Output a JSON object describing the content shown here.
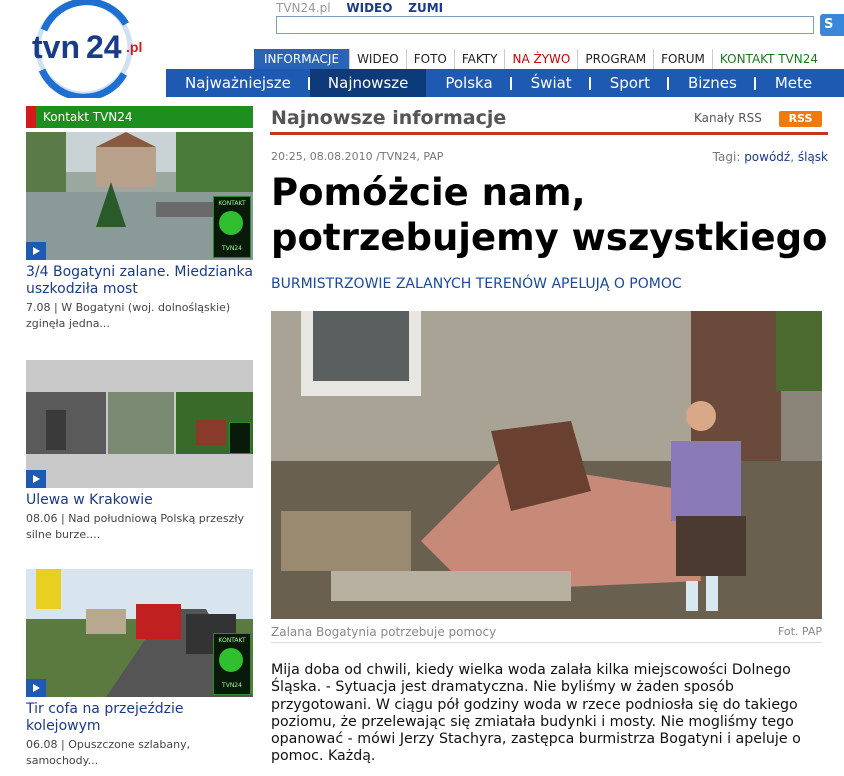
{
  "header": {
    "logo_text": "tvn24.pl",
    "top_links": [
      "TVN24.pl",
      "WIDEO",
      "ZUMI"
    ],
    "search_placeholder": "",
    "search_button": "S"
  },
  "top_nav": [
    "INFORMACJE",
    "WIDEO",
    "FOTO",
    "FAKTY",
    "NA ŻYWO",
    "PROGRAM",
    "FORUM",
    "KONTAKT TVN24"
  ],
  "main_nav": [
    "Najważniejsze",
    "Najnowsze",
    "Polska",
    "Świat",
    "Sport",
    "Biznes",
    "Mete"
  ],
  "sidebar": {
    "header": "Kontakt TVN24",
    "badge_text": "KONTAKT",
    "badge_sub": "TVN24",
    "items": [
      {
        "title": "3/4 Bogatyni zalane. Miedzianka uszkodziła most",
        "date": "7.08",
        "desc": "W Bogatyni (woj. dolnośląskie) zginęła jedna..."
      },
      {
        "title": "Ulewa w Krakowie",
        "date": "08.06",
        "desc": "Nad południową Polską przeszły silne burze...."
      },
      {
        "title": "Tir cofa na przejeździe kolejowym",
        "date": "06.08",
        "desc": "Opuszczone szlabany, samochody..."
      }
    ]
  },
  "article": {
    "section_title": "Najnowsze informacje",
    "rss_label": "Kanały RSS",
    "rss_badge": "RSS",
    "meta": "20:25, 08.08.2010 /TVN24, PAP",
    "tags_label": "Tagi:",
    "tags": [
      "powódź",
      "śląsk"
    ],
    "headline": "Pomóżcie nam, potrzebujemy wszystkiego",
    "subhead": "BURMISTRZOWIE ZALANYCH TERENÓW APELUJĄ O POMOC",
    "caption": "Zalana Bogatynia potrzebuje pomocy",
    "photo_credit": "Fot. PAP",
    "body": "Mija doba od chwili, kiedy wielka woda zalała kilka miejscowości Dolnego Śląska. - Sytuacja jest dramatyczna. Nie byliśmy w żaden sposób przygotowani. W ciągu pół godziny woda w rzece podniosła się do takiego poziomu, że przelewając się zmiatała budynki i mosty. Nie mogliśmy tego opanować - mówi Jerzy Stachyra, zastępca burmistrza Bogatyni i apeluje o pomoc. Każdą."
  }
}
